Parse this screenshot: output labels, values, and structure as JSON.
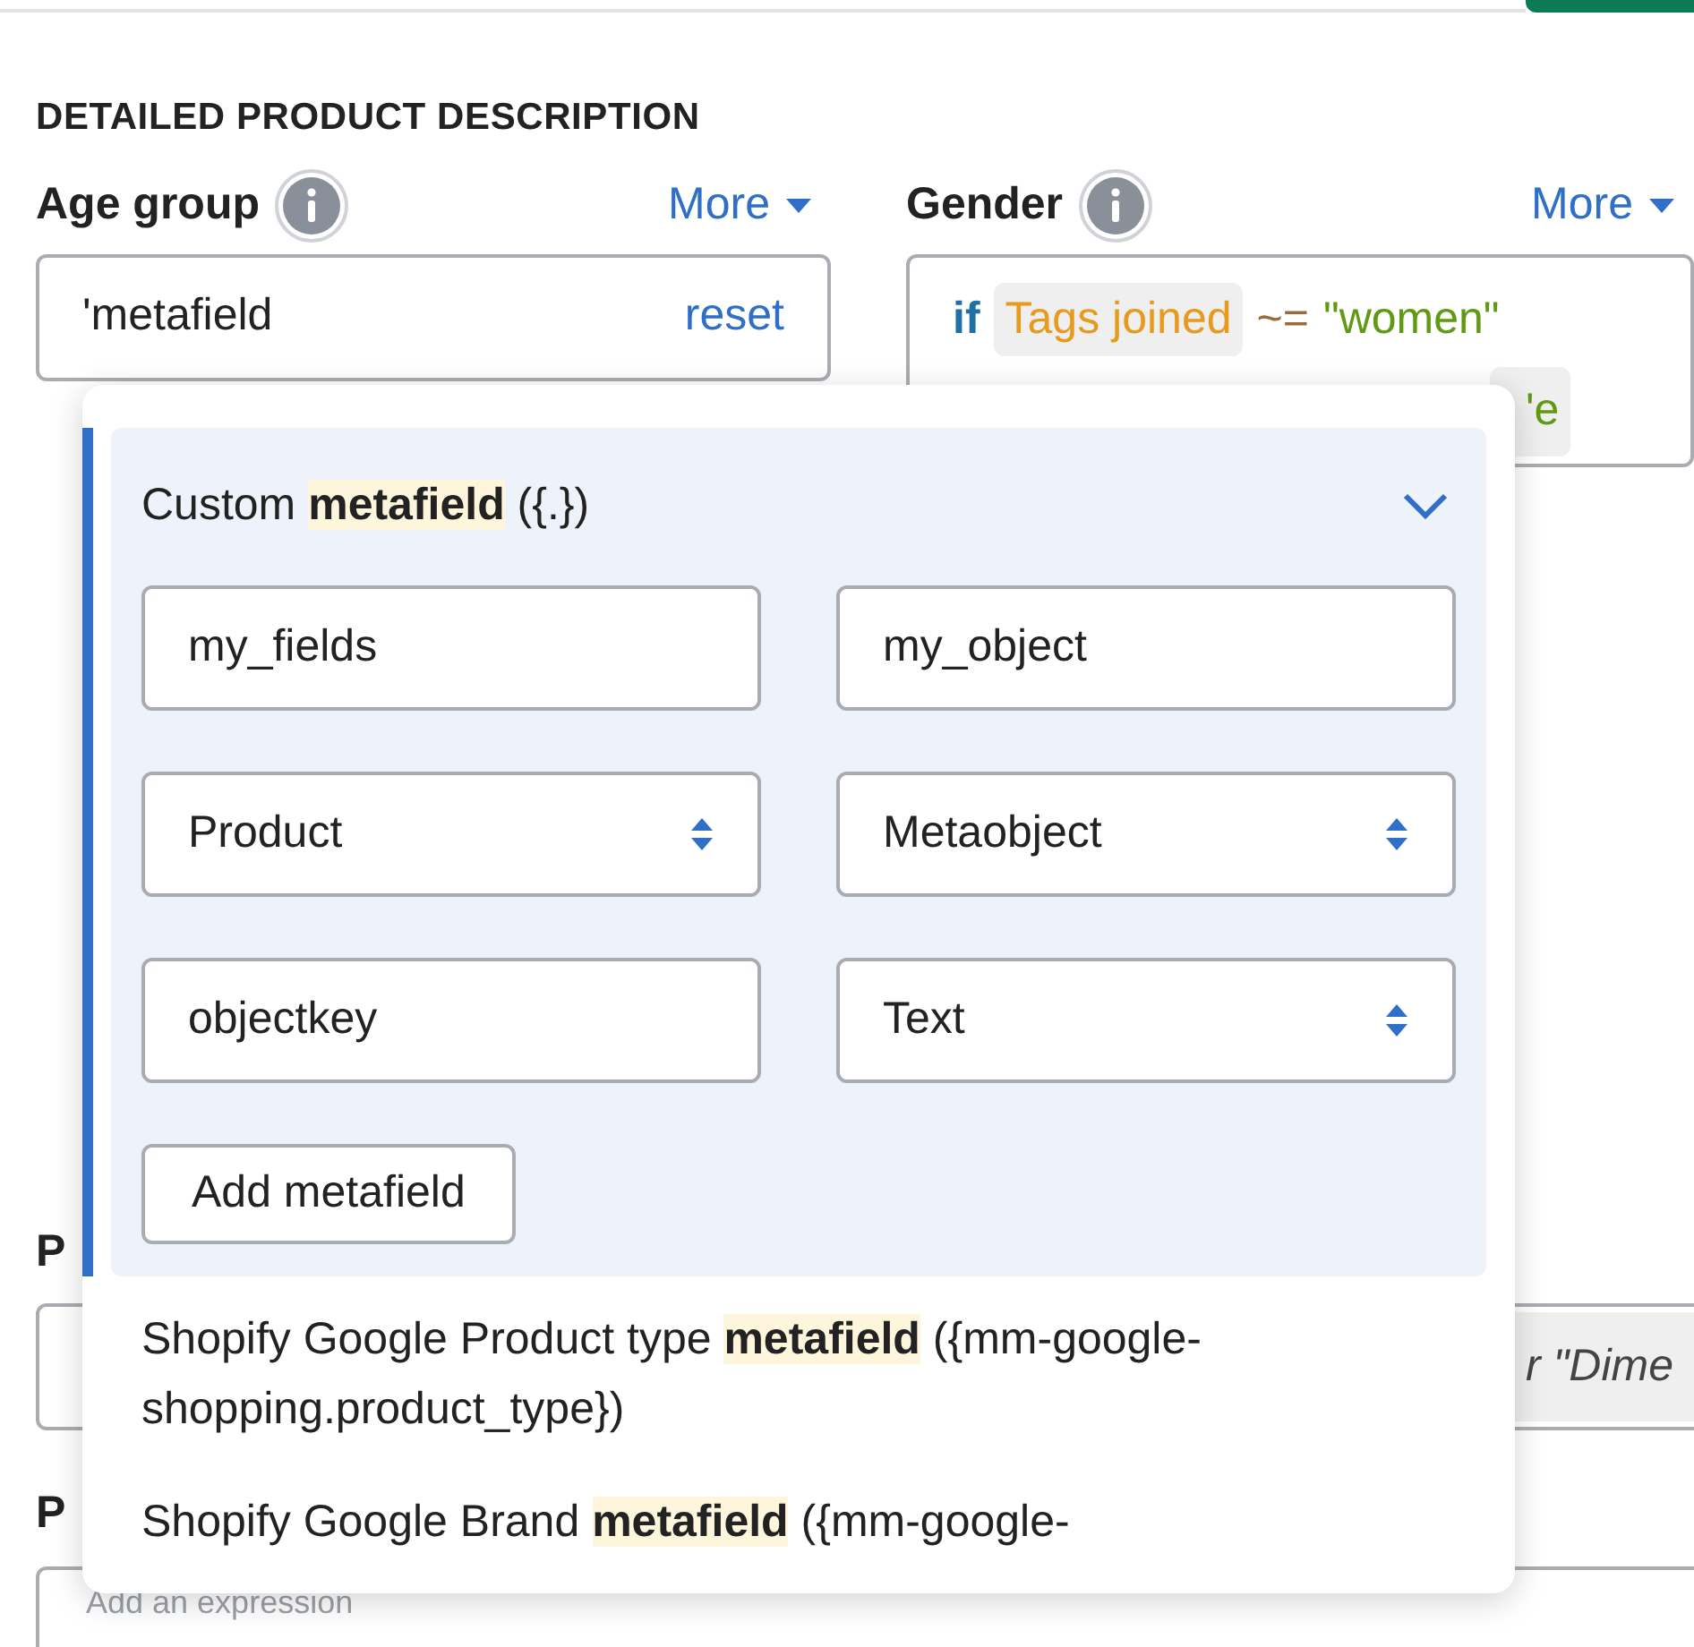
{
  "section_title": "DETAILED PRODUCT DESCRIPTION",
  "fields": [
    {
      "label": "Age group",
      "more": "More",
      "kind": "input",
      "value": "'metafield",
      "action": "reset"
    },
    {
      "label": "Gender",
      "more": "More",
      "kind": "expression",
      "lines": [
        [
          {
            "kind": "keyword",
            "text": "if"
          },
          {
            "kind": "field",
            "text": "Tags joined"
          },
          {
            "kind": "operator",
            "text": "~="
          },
          {
            "kind": "string",
            "text": "\"women\""
          }
        ],
        [
          {
            "kind": "string_chip",
            "text": "'e"
          }
        ]
      ]
    }
  ],
  "popup": {
    "items": [
      {
        "kind": "custom",
        "title": "Custom **metafield** ({.})",
        "selected": true,
        "expanded": true,
        "inputs": [
          {
            "kind": "text",
            "value": "my_fields"
          },
          {
            "kind": "text",
            "value": "my_object"
          },
          {
            "kind": "select",
            "value": "Product"
          },
          {
            "kind": "select",
            "value": "Metaobject"
          },
          {
            "kind": "text",
            "value": "objectkey"
          },
          {
            "kind": "select",
            "value": "Text"
          }
        ],
        "button": "Add metafield"
      },
      {
        "kind": "option",
        "title": "Shopify Google Product type **metafield** ({mm-google-shopping.product_type})",
        "selected": false
      },
      {
        "kind": "option",
        "title": "Shopify Google Brand **metafield** ({mm-google-",
        "selected": false
      }
    ]
  },
  "lower_fields": [
    {
      "label": "P",
      "chip": "r \"Dime"
    },
    {
      "label": "P",
      "placeholder": "Add an expression"
    }
  ]
}
